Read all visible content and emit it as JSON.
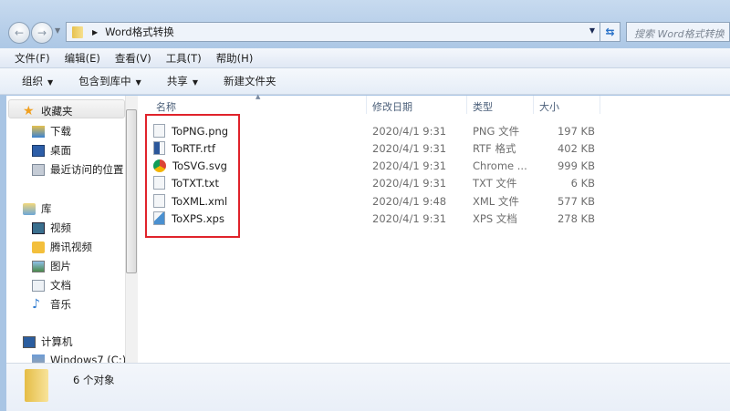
{
  "window": {
    "address_path": "Word格式转换",
    "search_placeholder": "搜索 Word格式转换"
  },
  "menu": [
    "文件(F)",
    "编辑(E)",
    "查看(V)",
    "工具(T)",
    "帮助(H)"
  ],
  "toolbar": [
    {
      "label": "组织",
      "dropdown": true
    },
    {
      "label": "包含到库中",
      "dropdown": true
    },
    {
      "label": "共享",
      "dropdown": true
    },
    {
      "label": "新建文件夹",
      "dropdown": false
    }
  ],
  "nav": {
    "favorites": {
      "label": "收藏夹",
      "items": [
        "下载",
        "桌面",
        "最近访问的位置"
      ]
    },
    "libraries": {
      "label": "库",
      "items": [
        "视频",
        "腾讯视频",
        "图片",
        "文档",
        "音乐"
      ]
    },
    "computer": {
      "label": "计算机",
      "items": [
        "Windows7 (C:)"
      ]
    }
  },
  "columns": {
    "name": "名称",
    "date": "修改日期",
    "type": "类型",
    "size": "大小"
  },
  "files": [
    {
      "name": "ToPNG.png",
      "date": "2020/4/1 9:31",
      "type": "PNG 文件",
      "size": "197 KB",
      "icon": "png-file-icon"
    },
    {
      "name": "ToRTF.rtf",
      "date": "2020/4/1 9:31",
      "type": "RTF 格式",
      "size": "402 KB",
      "icon": "word-file-icon"
    },
    {
      "name": "ToSVG.svg",
      "date": "2020/4/1 9:31",
      "type": "Chrome ...",
      "size": "999 KB",
      "icon": "chrome-icon"
    },
    {
      "name": "ToTXT.txt",
      "date": "2020/4/1 9:31",
      "type": "TXT 文件",
      "size": "6 KB",
      "icon": "text-file-icon"
    },
    {
      "name": "ToXML.xml",
      "date": "2020/4/1 9:48",
      "type": "XML 文件",
      "size": "577 KB",
      "icon": "text-file-icon"
    },
    {
      "name": "ToXPS.xps",
      "date": "2020/4/1 9:31",
      "type": "XPS 文档",
      "size": "278 KB",
      "icon": "xps-file-icon"
    }
  ],
  "status": {
    "count": "6 个对象"
  },
  "colors": {
    "highlight_box": "#e0232b"
  }
}
